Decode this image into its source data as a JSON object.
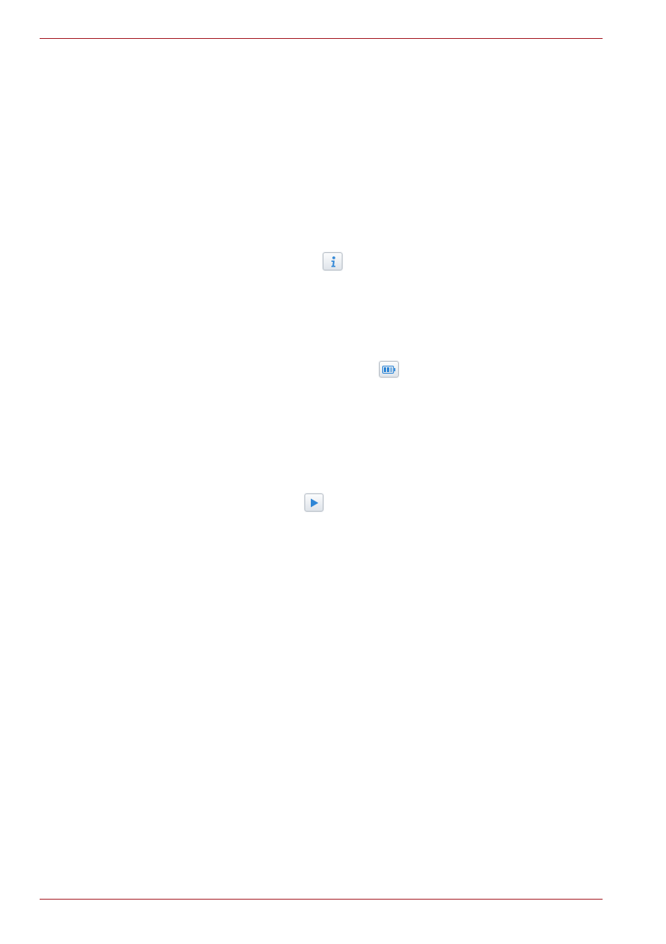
{
  "colors": {
    "rule": "#a8232b",
    "icon_blue": "#2f86d6",
    "icon_border": "#b9c0c8"
  },
  "icons": {
    "info": "info-icon",
    "battery": "battery-icon",
    "play": "play-icon"
  }
}
